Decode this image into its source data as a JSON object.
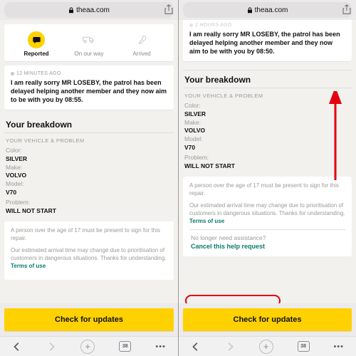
{
  "url_host": "theaa.com",
  "steps": [
    {
      "icon": "chat",
      "label": "Reported",
      "active": true
    },
    {
      "icon": "truck",
      "label": "On our way",
      "active": false
    },
    {
      "icon": "wrench",
      "label": "Arrived",
      "active": false
    }
  ],
  "left": {
    "timestamp": "12 MINUTES AGO",
    "message": "I am really sorry MR LOSEBY, the patrol has been delayed helping another member and they now aim to be with you by 08:55."
  },
  "right": {
    "timestamp": "2 HOURS AGO",
    "message": "I am really sorry MR LOSEBY, the patrol has been delayed helping another member and they now aim to be with you by 08:50."
  },
  "breakdown": {
    "title": "Your breakdown",
    "sub": "YOUR VEHICLE & PROBLEM",
    "color_k": "Color:",
    "color_v": "SILVER",
    "make_k": "Make:",
    "make_v": "VOLVO",
    "model_k": "Model:",
    "model_v": "V70",
    "problem_k": "Problem:",
    "problem_v": "WILL NOT START"
  },
  "notes": {
    "age": "A person over the age of 17 must be present to sign for this repair.",
    "eta": "Our estimated arrival time may change due to prioritisation of customers in dangerous situations. Thanks for understanding. ",
    "terms": "Terms of use"
  },
  "cancel": {
    "q": "No longer need assistance?",
    "link": "Cancel this help request"
  },
  "check": "Check for updates",
  "nav": {
    "tabs": "38",
    "dots": "•••"
  }
}
